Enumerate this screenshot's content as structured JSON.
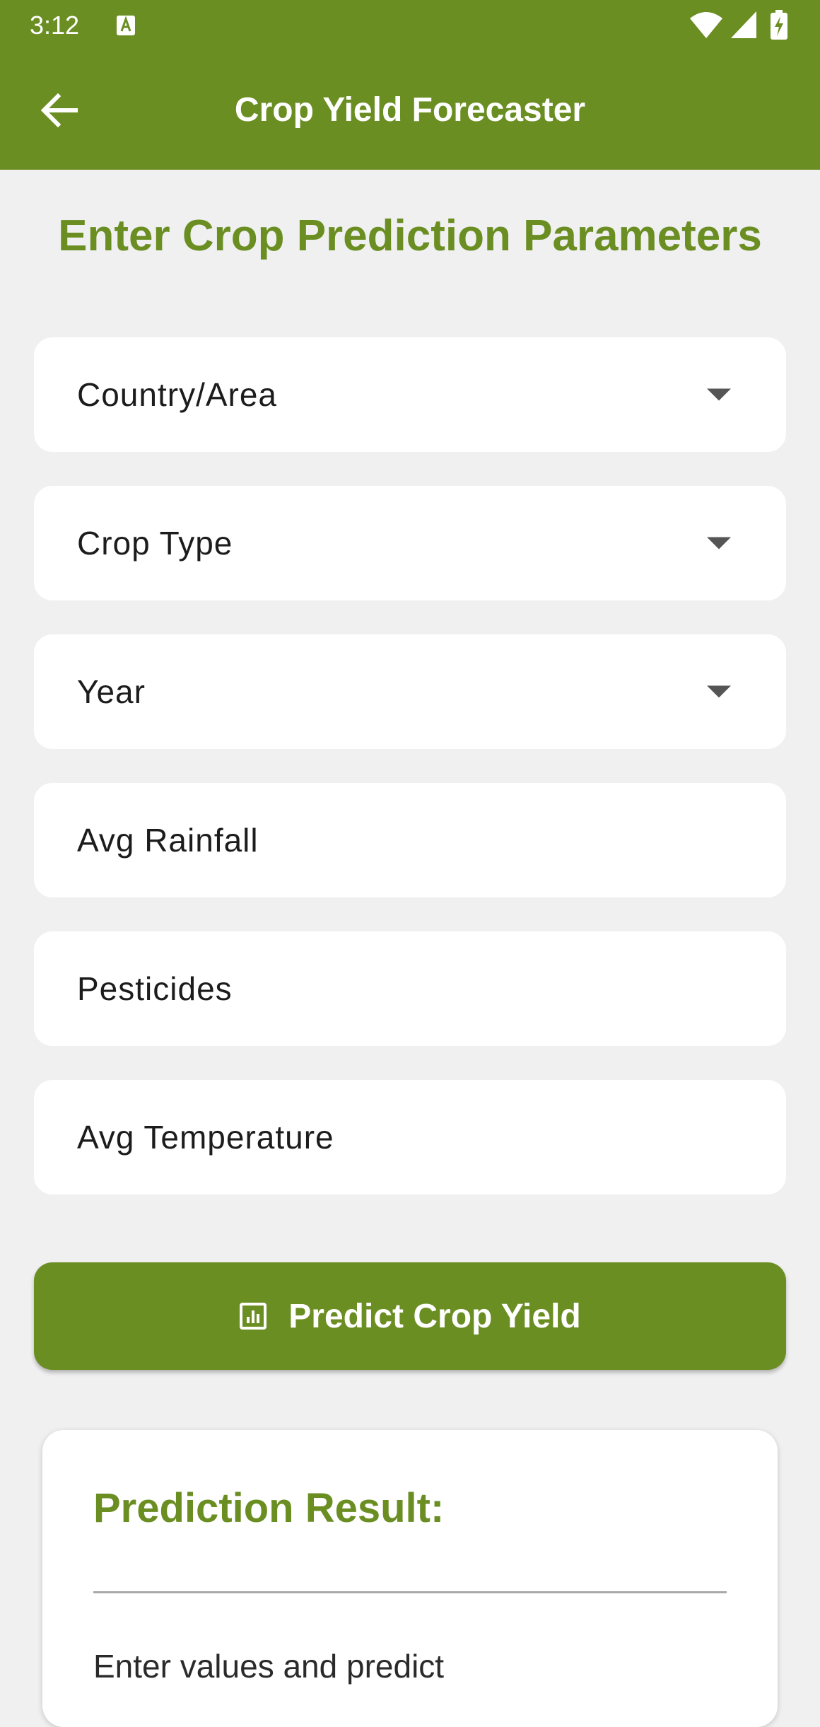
{
  "status_bar": {
    "time": "3:12",
    "icons": [
      "notification-a-icon",
      "wifi-icon",
      "cell-signal-icon",
      "battery-charging-icon"
    ]
  },
  "app_bar": {
    "title": "Crop Yield Forecaster",
    "back_icon": "arrow-left-icon",
    "color": "#6b8e23"
  },
  "form": {
    "heading": "Enter Crop Prediction Parameters",
    "fields": [
      {
        "label": "Country/Area",
        "type": "dropdown"
      },
      {
        "label": "Crop Type",
        "type": "dropdown"
      },
      {
        "label": "Year",
        "type": "dropdown"
      },
      {
        "label": "Avg Rainfall",
        "type": "text"
      },
      {
        "label": "Pesticides",
        "type": "text"
      },
      {
        "label": "Avg Temperature",
        "type": "text"
      }
    ],
    "submit_label": "Predict Crop Yield",
    "submit_icon": "analytics-icon"
  },
  "result": {
    "title": "Prediction Result:",
    "text": "Enter values and predict"
  },
  "colors": {
    "accent": "#6b8e23",
    "background": "#f0f0f0",
    "card": "#ffffff"
  }
}
